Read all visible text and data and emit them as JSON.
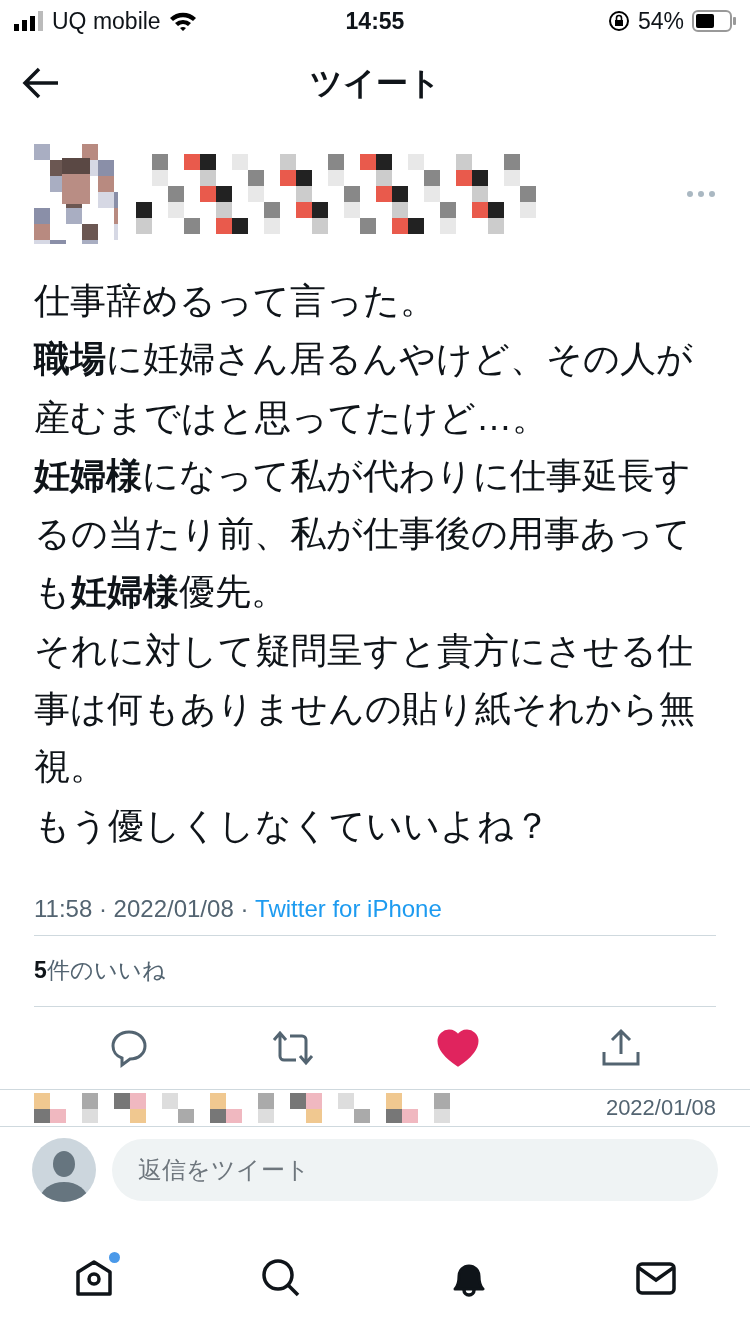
{
  "status_bar": {
    "carrier": "UQ mobile",
    "time": "14:55",
    "battery": "54%"
  },
  "header": {
    "title": "ツイート"
  },
  "tweet": {
    "body": [
      "仕事辞めるって言った。",
      "**職場**に妊婦さん居るんやけど、その人が産むまではと思ってたけど…。",
      "**妊婦様**になって私が代わりに仕事延長するの当たり前、私が仕事後の用事あっても**妊婦様**優先。",
      "それに対して疑問呈すと貴方にさせる仕事は何もありませんの貼り紙それから無視。",
      "もう優しくしなくていいよね？"
    ],
    "time": "11:58 · 2022/01/08 · ",
    "source": "Twitter for iPhone",
    "likes_count": "5",
    "likes_label": "件のいいね",
    "liked": true
  },
  "reply_preview": {
    "date": "2022/01/08"
  },
  "reply_field": {
    "placeholder": "返信をツイート"
  },
  "tabs": [
    {
      "kind": "home",
      "selected": false,
      "badge": true
    },
    {
      "kind": "search",
      "selected": false,
      "badge": false
    },
    {
      "kind": "notifications",
      "selected": true,
      "badge": false
    },
    {
      "kind": "messages",
      "selected": false,
      "badge": false
    }
  ]
}
